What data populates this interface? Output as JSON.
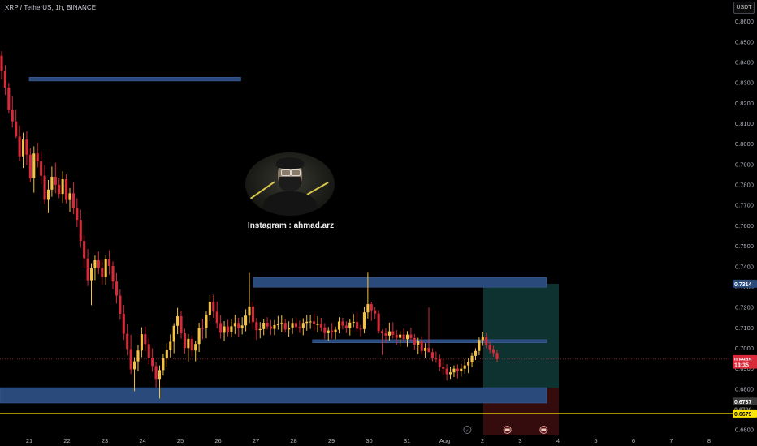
{
  "header": {
    "title": "XRP / TetherUS, 1h, BINANCE",
    "currency": "USDT"
  },
  "watermark": {
    "text": "Instagram : ahmad.arz"
  },
  "colors": {
    "up": "#f5c242",
    "down": "#d92a3a",
    "zone": "#2b4a7c",
    "yellow_line": "#ffe600",
    "profit": "#0f3b37",
    "loss": "#3a0d10"
  },
  "chart_data": {
    "type": "candlestick",
    "y_ticks": [
      "0.8600",
      "0.8500",
      "0.8400",
      "0.8300",
      "0.8200",
      "0.8100",
      "0.8000",
      "0.7900",
      "0.7800",
      "0.7700",
      "0.7600",
      "0.7500",
      "0.7400",
      "0.7300",
      "0.7200",
      "0.7100",
      "0.7000",
      "0.6900",
      "0.6800",
      "0.6700",
      "0.6600"
    ],
    "x_ticks": [
      "21",
      "22",
      "23",
      "24",
      "25",
      "26",
      "27",
      "28",
      "29",
      "30",
      "31",
      "Aug",
      "2",
      "3",
      "4",
      "5",
      "6",
      "7",
      "8"
    ],
    "ylim": [
      0.6575,
      0.866
    ],
    "price_labels": [
      {
        "text": "0.7314",
        "value": 0.7314,
        "bg": "#2b4a7c",
        "fg": "#ffffff"
      },
      {
        "text": "0.6945",
        "value": 0.6945,
        "bg": "#d92a3a",
        "fg": "#ffffff"
      },
      {
        "text": "13:35",
        "value": 0.6918,
        "bg": "#d92a3a",
        "fg": "#ffffff"
      },
      {
        "text": "0.6737",
        "value": 0.6737,
        "bg": "#3a3a3a",
        "fg": "#ffffff"
      },
      {
        "text": "0.6700",
        "value": 0.67,
        "bg": "#000000",
        "fg": "#8a8a8a"
      },
      {
        "text": "0.6679",
        "value": 0.6679,
        "bg": "#ffe600",
        "fg": "#000000"
      }
    ],
    "zones": [
      {
        "x_start": 21.0,
        "x_end": 26.6,
        "y_top": 0.8325,
        "y_bottom": 0.8307
      },
      {
        "x_start": 26.93,
        "x_end": 34.7,
        "y_top": 0.7345,
        "y_bottom": 0.7297
      },
      {
        "x_start": 28.5,
        "x_end": 34.7,
        "y_top": 0.704,
        "y_bottom": 0.7025
      },
      {
        "x_start": 20.0,
        "x_end": 34.7,
        "y_top": 0.6805,
        "y_bottom": 0.673
      }
    ],
    "yellow_line": 0.6679,
    "position": {
      "x_start": 33.0,
      "x_end": 35.0,
      "entry": 0.6805,
      "target": 0.7314,
      "stop": 0.6575
    },
    "current_price": 0.6945,
    "candles_ohlc": [
      [
        0.8431,
        0.8453,
        0.8315,
        0.8356
      ],
      [
        0.8356,
        0.8385,
        0.8239,
        0.8274
      ],
      [
        0.8274,
        0.8297,
        0.8151,
        0.8164
      ],
      [
        0.8164,
        0.8231,
        0.8079,
        0.8109
      ],
      [
        0.8109,
        0.8165,
        0.8027,
        0.8035
      ],
      [
        0.8035,
        0.8089,
        0.7915,
        0.7938
      ],
      [
        0.7938,
        0.8054,
        0.7881,
        0.802
      ],
      [
        0.802,
        0.806,
        0.7895,
        0.7946
      ],
      [
        0.7946,
        0.7977,
        0.7812,
        0.7831
      ],
      [
        0.7831,
        0.7987,
        0.776,
        0.7952
      ],
      [
        0.7952,
        0.8006,
        0.7884,
        0.7913
      ],
      [
        0.7913,
        0.7964,
        0.7802,
        0.7843
      ],
      [
        0.7843,
        0.7895,
        0.7704,
        0.7725
      ],
      [
        0.7725,
        0.7822,
        0.766,
        0.7775
      ],
      [
        0.7775,
        0.7888,
        0.774,
        0.7838
      ],
      [
        0.7838,
        0.7907,
        0.7757,
        0.7799
      ],
      [
        0.7799,
        0.783,
        0.7733,
        0.7754
      ],
      [
        0.7754,
        0.7865,
        0.771,
        0.7826
      ],
      [
        0.7826,
        0.785,
        0.7707,
        0.7724
      ],
      [
        0.7724,
        0.7783,
        0.7666,
        0.7757
      ],
      [
        0.7757,
        0.7813,
        0.7655,
        0.7686
      ],
      [
        0.7686,
        0.7733,
        0.7591,
        0.7627
      ],
      [
        0.7627,
        0.7677,
        0.7491,
        0.7524
      ],
      [
        0.7524,
        0.7551,
        0.7393,
        0.7438
      ],
      [
        0.7438,
        0.7484,
        0.7303,
        0.7331
      ],
      [
        0.7331,
        0.7415,
        0.7209,
        0.7389
      ],
      [
        0.7389,
        0.7452,
        0.7332,
        0.7429
      ],
      [
        0.7429,
        0.7472,
        0.7362,
        0.7391
      ],
      [
        0.7391,
        0.7431,
        0.7308,
        0.7347
      ],
      [
        0.7347,
        0.7453,
        0.7308,
        0.7433
      ],
      [
        0.7433,
        0.7478,
        0.7359,
        0.7401
      ],
      [
        0.7401,
        0.7423,
        0.7287,
        0.7325
      ],
      [
        0.7325,
        0.7366,
        0.7217,
        0.7256
      ],
      [
        0.7256,
        0.7287,
        0.7138,
        0.7167
      ],
      [
        0.7167,
        0.7211,
        0.7039,
        0.7069
      ],
      [
        0.7069,
        0.7115,
        0.6963,
        0.6994
      ],
      [
        0.6994,
        0.7064,
        0.6872,
        0.6895
      ],
      [
        0.6895,
        0.6954,
        0.6788,
        0.6934
      ],
      [
        0.6934,
        0.7014,
        0.6885,
        0.6987
      ],
      [
        0.6987,
        0.7101,
        0.6954,
        0.7067
      ],
      [
        0.7067,
        0.7104,
        0.6985,
        0.7018
      ],
      [
        0.7018,
        0.7046,
        0.692,
        0.6952
      ],
      [
        0.6952,
        0.6998,
        0.6883,
        0.6911
      ],
      [
        0.6911,
        0.6929,
        0.6806,
        0.6848
      ],
      [
        0.6848,
        0.6914,
        0.6752,
        0.6891
      ],
      [
        0.6891,
        0.6971,
        0.6864,
        0.695
      ],
      [
        0.695,
        0.7021,
        0.6909,
        0.699
      ],
      [
        0.699,
        0.7066,
        0.6953,
        0.703
      ],
      [
        0.703,
        0.7121,
        0.6974,
        0.7108
      ],
      [
        0.7108,
        0.7196,
        0.7067,
        0.7155
      ],
      [
        0.7155,
        0.7181,
        0.7045,
        0.7071
      ],
      [
        0.7071,
        0.7094,
        0.6972,
        0.6999
      ],
      [
        0.6999,
        0.7068,
        0.6933,
        0.7044
      ],
      [
        0.7044,
        0.7062,
        0.6957,
        0.6987
      ],
      [
        0.6987,
        0.7034,
        0.6934,
        0.7019
      ],
      [
        0.7019,
        0.7123,
        0.698,
        0.7097
      ],
      [
        0.7097,
        0.7143,
        0.7042,
        0.7096
      ],
      [
        0.7096,
        0.7178,
        0.7047,
        0.7163
      ],
      [
        0.7163,
        0.7258,
        0.7131,
        0.7226
      ],
      [
        0.7226,
        0.7261,
        0.7147,
        0.7177
      ],
      [
        0.7177,
        0.7227,
        0.7095,
        0.7122
      ],
      [
        0.7122,
        0.716,
        0.7045,
        0.7074
      ],
      [
        0.7074,
        0.7131,
        0.7033,
        0.7105
      ],
      [
        0.7105,
        0.7137,
        0.7057,
        0.7079
      ],
      [
        0.7079,
        0.7139,
        0.7051,
        0.7106
      ],
      [
        0.7106,
        0.7162,
        0.7067,
        0.7122
      ],
      [
        0.7122,
        0.7148,
        0.7051,
        0.7096
      ],
      [
        0.7096,
        0.715,
        0.7066,
        0.711
      ],
      [
        0.711,
        0.7189,
        0.7081,
        0.7158
      ],
      [
        0.7158,
        0.7367,
        0.7122,
        0.7203
      ],
      [
        0.7203,
        0.7226,
        0.709,
        0.7126
      ],
      [
        0.7126,
        0.7146,
        0.7039,
        0.7087
      ],
      [
        0.7087,
        0.7126,
        0.7047,
        0.7092
      ],
      [
        0.7092,
        0.7141,
        0.7062,
        0.7123
      ],
      [
        0.7123,
        0.715,
        0.709,
        0.7105
      ],
      [
        0.7105,
        0.7136,
        0.7064,
        0.7093
      ],
      [
        0.7093,
        0.7136,
        0.7063,
        0.7111
      ],
      [
        0.7111,
        0.7156,
        0.7089,
        0.7115
      ],
      [
        0.7115,
        0.716,
        0.7076,
        0.7122
      ],
      [
        0.7122,
        0.714,
        0.7074,
        0.709
      ],
      [
        0.709,
        0.713,
        0.7054,
        0.7098
      ],
      [
        0.7098,
        0.7146,
        0.7068,
        0.7122
      ],
      [
        0.7122,
        0.7148,
        0.7088,
        0.7102
      ],
      [
        0.7102,
        0.7133,
        0.7073,
        0.7097
      ],
      [
        0.7097,
        0.7145,
        0.7062,
        0.7122
      ],
      [
        0.7122,
        0.7161,
        0.7084,
        0.7128
      ],
      [
        0.7128,
        0.7162,
        0.7093,
        0.7129
      ],
      [
        0.7129,
        0.7168,
        0.7085,
        0.7116
      ],
      [
        0.7116,
        0.7155,
        0.7077,
        0.7116
      ],
      [
        0.7116,
        0.7147,
        0.7081,
        0.71
      ],
      [
        0.71,
        0.7121,
        0.7043,
        0.7072
      ],
      [
        0.7072,
        0.7102,
        0.7035,
        0.7085
      ],
      [
        0.7085,
        0.7122,
        0.7045,
        0.7076
      ],
      [
        0.7076,
        0.7104,
        0.7042,
        0.7089
      ],
      [
        0.7089,
        0.715,
        0.7071,
        0.7129
      ],
      [
        0.7129,
        0.7147,
        0.7091,
        0.7109
      ],
      [
        0.7109,
        0.713,
        0.7072,
        0.7097
      ],
      [
        0.7097,
        0.7143,
        0.7061,
        0.7124
      ],
      [
        0.7124,
        0.7166,
        0.7101,
        0.7127
      ],
      [
        0.7127,
        0.7175,
        0.7078,
        0.7094
      ],
      [
        0.7094,
        0.7113,
        0.7057,
        0.7092
      ],
      [
        0.7092,
        0.7201,
        0.7071,
        0.7174
      ],
      [
        0.7174,
        0.7368,
        0.7144,
        0.7214
      ],
      [
        0.7214,
        0.7225,
        0.7132,
        0.7184
      ],
      [
        0.7184,
        0.72,
        0.7141,
        0.7168
      ],
      [
        0.7168,
        0.7184,
        0.707,
        0.7082
      ],
      [
        0.7082,
        0.709,
        0.6964,
        0.7071
      ],
      [
        0.7071,
        0.7096,
        0.7025,
        0.706
      ],
      [
        0.706,
        0.7124,
        0.7035,
        0.7081
      ],
      [
        0.7081,
        0.7125,
        0.7045,
        0.7064
      ],
      [
        0.7064,
        0.7087,
        0.7015,
        0.7049
      ],
      [
        0.7049,
        0.7082,
        0.7006,
        0.7065
      ],
      [
        0.7065,
        0.7095,
        0.703,
        0.7043
      ],
      [
        0.7043,
        0.7082,
        0.7005,
        0.7065
      ],
      [
        0.7065,
        0.7099,
        0.703,
        0.7048
      ],
      [
        0.7048,
        0.7068,
        0.699,
        0.7016
      ],
      [
        0.7016,
        0.7049,
        0.6969,
        0.7032
      ],
      [
        0.7032,
        0.7057,
        0.6967,
        0.6985
      ],
      [
        0.6985,
        0.7023,
        0.6952,
        0.7
      ],
      [
        0.7,
        0.7198,
        0.699,
        0.6979
      ],
      [
        0.6979,
        0.6998,
        0.6934,
        0.6951
      ],
      [
        0.6951,
        0.6982,
        0.6927,
        0.6946
      ],
      [
        0.6946,
        0.6968,
        0.6886,
        0.6906
      ],
      [
        0.6906,
        0.6943,
        0.6867,
        0.6898
      ],
      [
        0.6898,
        0.6921,
        0.684,
        0.6871
      ],
      [
        0.6871,
        0.6908,
        0.6848,
        0.688
      ],
      [
        0.688,
        0.6914,
        0.6857,
        0.6898
      ],
      [
        0.6898,
        0.6919,
        0.685,
        0.6885
      ],
      [
        0.6885,
        0.6922,
        0.6859,
        0.6898
      ],
      [
        0.6898,
        0.6944,
        0.6874,
        0.6914
      ],
      [
        0.6914,
        0.695,
        0.6876,
        0.6929
      ],
      [
        0.6929,
        0.6977,
        0.6905,
        0.6961
      ],
      [
        0.6961,
        0.6998,
        0.694,
        0.6985
      ],
      [
        0.6985,
        0.7051,
        0.6964,
        0.7038
      ],
      [
        0.7038,
        0.7079,
        0.701,
        0.7055
      ],
      [
        0.7055,
        0.7073,
        0.6998,
        0.7013
      ],
      [
        0.7013,
        0.703,
        0.6974,
        0.6993
      ],
      [
        0.6993,
        0.701,
        0.6957,
        0.6975
      ],
      [
        0.6975,
        0.699,
        0.693,
        0.6945
      ]
    ]
  }
}
